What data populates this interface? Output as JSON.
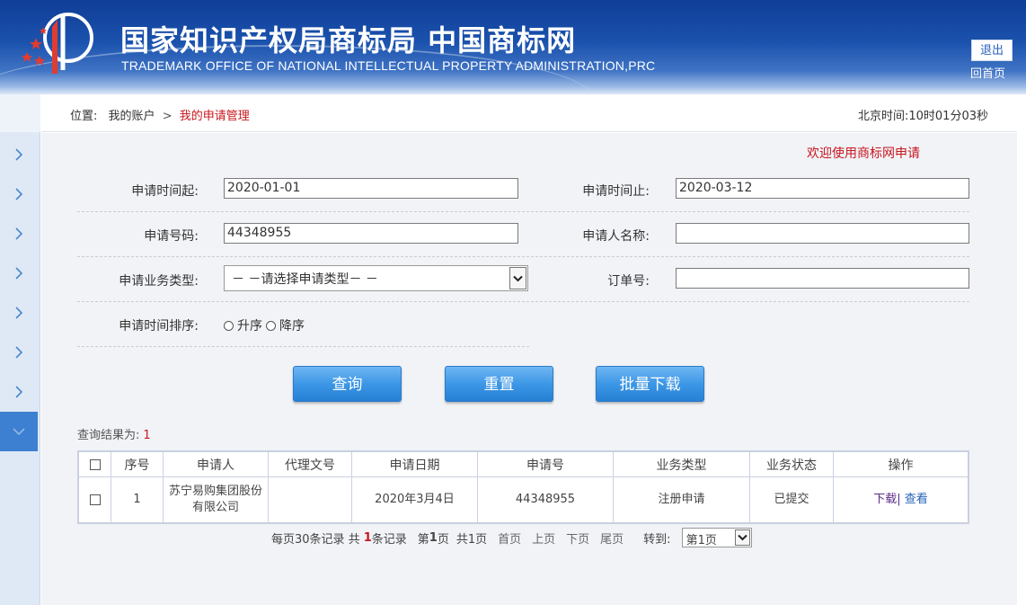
{
  "header": {
    "title_cn": "国家知识产权局商标局 中国商标网",
    "title_en": "TRADEMARK OFFICE OF NATIONAL INTELLECTUAL PROPERTY ADMINISTRATION,PRC",
    "logout_label": "退出",
    "home_label": "回首页"
  },
  "breadcrumb": {
    "prefix": "位置:",
    "item1": "我的账户",
    "separator": ">",
    "current": "我的申请管理"
  },
  "clock": "北京时间:10时01分03秒",
  "welcome": "欢迎使用商标网申请",
  "form": {
    "start_label": "申请时间起:",
    "start_value": "2020-01-01",
    "end_label": "申请时间止:",
    "end_value": "2020-03-12",
    "appno_label": "申请号码:",
    "appno_value": "44348955",
    "applicant_label": "申请人名称:",
    "applicant_value": "",
    "biztype_label": "申请业务类型:",
    "biztype_value": "－ －请选择申请类型－ －",
    "order_label": "订单号:",
    "order_value": "",
    "sort_label": "申请时间排序:",
    "sort_asc": "升序",
    "sort_desc": "降序"
  },
  "buttons": {
    "query": "查询",
    "reset": "重置",
    "batch_download": "批量下载"
  },
  "result": {
    "label": "查询结果为:",
    "count": "1"
  },
  "table": {
    "headers": [
      "序号",
      "申请人",
      "代理文号",
      "申请日期",
      "申请号",
      "业务类型",
      "业务状态",
      "操作"
    ],
    "rows": [
      {
        "index": "1",
        "applicant": "苏宁易购集团股份有限公司",
        "agent_no": "",
        "date": "2020年3月4日",
        "app_no": "44348955",
        "biz_type": "注册申请",
        "status": "已提交",
        "op_download": "下载",
        "op_sep": "|",
        "op_view": "查看"
      }
    ]
  },
  "pager": {
    "per_page": "每页30条记录 共",
    "total": "1",
    "total_suffix": "条记录",
    "page_prefix": "第",
    "page_num": "1",
    "page_suffix": "页",
    "total_pages": "共1页",
    "first": "首页",
    "prev": "上页",
    "next": "下页",
    "last": "尾页",
    "jump_label": "转到:",
    "jump_value": "第1页"
  },
  "colors": {
    "header_blue": "#1b52ad",
    "accent_red": "#c8161d",
    "button_blue": "#3d97e6",
    "sidebar_active": "#3d7fd0"
  },
  "icons": [
    "logo-emblem",
    "chevron-right-icon",
    "chevron-down-icon",
    "dropdown-arrow-icon"
  ]
}
